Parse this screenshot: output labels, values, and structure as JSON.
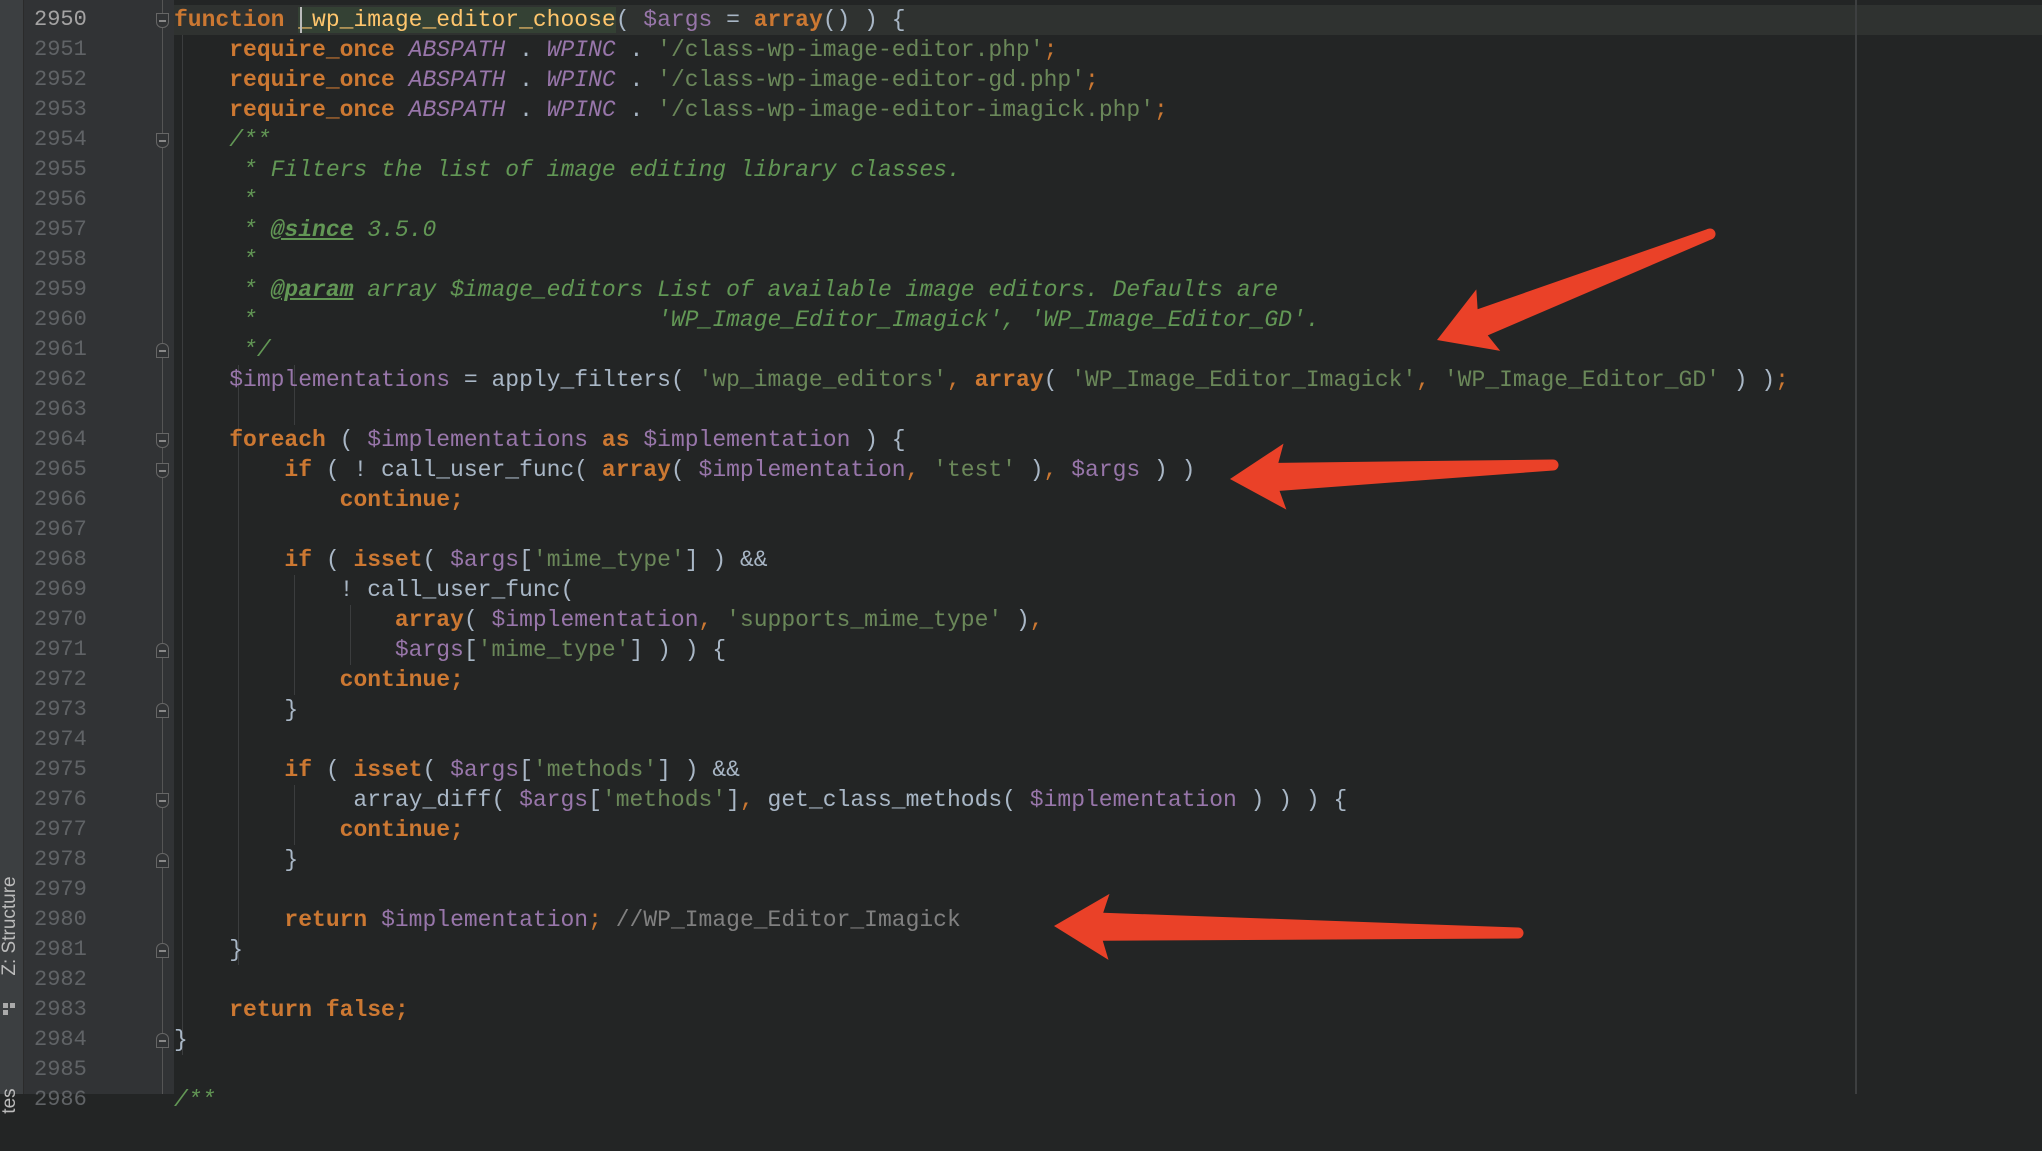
{
  "toolstrip": {
    "structure_label": "Z: Structure",
    "favorites_label": "tes"
  },
  "editor": {
    "first_line_number": 2950,
    "current_line": 2950,
    "annotation_color": "#ea4128",
    "fold_markers": {
      "2950": "top",
      "2954": "top",
      "2961": "bot",
      "2964": "top",
      "2965": "top",
      "2971": "bot",
      "2973": "bot",
      "2976": "top",
      "2978": "bot",
      "2981": "bot",
      "2984": "bot"
    },
    "lines": [
      [
        [
          "k",
          "function"
        ],
        [
          "p",
          " "
        ],
        [
          "f",
          "_wp_image_editor_choose"
        ],
        [
          "p",
          "( "
        ],
        [
          "v",
          "$args"
        ],
        [
          "p",
          " = "
        ],
        [
          "k",
          "array"
        ],
        [
          "p",
          "() ) {"
        ]
      ],
      [
        [
          "p",
          "    "
        ],
        [
          "k",
          "require_once"
        ],
        [
          "p",
          " "
        ],
        [
          "c",
          "ABSPATH"
        ],
        [
          "p",
          " . "
        ],
        [
          "c",
          "WPINC"
        ],
        [
          "p",
          " . "
        ],
        [
          "s",
          "'/class-wp-image-editor.php'"
        ],
        [
          "o",
          ";"
        ]
      ],
      [
        [
          "p",
          "    "
        ],
        [
          "k",
          "require_once"
        ],
        [
          "p",
          " "
        ],
        [
          "c",
          "ABSPATH"
        ],
        [
          "p",
          " . "
        ],
        [
          "c",
          "WPINC"
        ],
        [
          "p",
          " . "
        ],
        [
          "s",
          "'/class-wp-image-editor-gd.php'"
        ],
        [
          "o",
          ";"
        ]
      ],
      [
        [
          "p",
          "    "
        ],
        [
          "k",
          "require_once"
        ],
        [
          "p",
          " "
        ],
        [
          "c",
          "ABSPATH"
        ],
        [
          "p",
          " . "
        ],
        [
          "c",
          "WPINC"
        ],
        [
          "p",
          " . "
        ],
        [
          "s",
          "'/class-wp-image-editor-imagick.php'"
        ],
        [
          "o",
          ";"
        ]
      ],
      [
        [
          "p",
          "    "
        ],
        [
          "d",
          "/**"
        ]
      ],
      [
        [
          "p",
          "     "
        ],
        [
          "d",
          "* Filters the list of image editing library classes."
        ]
      ],
      [
        [
          "p",
          "     "
        ],
        [
          "d",
          "*"
        ]
      ],
      [
        [
          "p",
          "     "
        ],
        [
          "d",
          "* "
        ],
        [
          "t",
          "@since"
        ],
        [
          "d",
          " 3.5.0"
        ]
      ],
      [
        [
          "p",
          "     "
        ],
        [
          "d",
          "*"
        ]
      ],
      [
        [
          "p",
          "     "
        ],
        [
          "d",
          "* "
        ],
        [
          "t",
          "@param"
        ],
        [
          "d",
          " array $image_editors List of available image editors. Defaults are"
        ]
      ],
      [
        [
          "p",
          "     "
        ],
        [
          "d",
          "*                             'WP_Image_Editor_Imagick', 'WP_Image_Editor_GD'."
        ]
      ],
      [
        [
          "p",
          "     "
        ],
        [
          "d",
          "*/"
        ]
      ],
      [
        [
          "p",
          "    "
        ],
        [
          "v",
          "$implementations"
        ],
        [
          "p",
          " = apply_filters( "
        ],
        [
          "s",
          "'wp_image_editors'"
        ],
        [
          "o",
          ", "
        ],
        [
          "k",
          "array"
        ],
        [
          "p",
          "( "
        ],
        [
          "s",
          "'WP_Image_Editor_Imagick'"
        ],
        [
          "o",
          ", "
        ],
        [
          "s",
          "'WP_Image_Editor_GD'"
        ],
        [
          "p",
          " ) )"
        ],
        [
          "o",
          ";"
        ]
      ],
      [],
      [
        [
          "p",
          "    "
        ],
        [
          "k",
          "foreach"
        ],
        [
          "p",
          " ( "
        ],
        [
          "v",
          "$implementations"
        ],
        [
          "p",
          " "
        ],
        [
          "k",
          "as"
        ],
        [
          "p",
          " "
        ],
        [
          "v",
          "$implementation"
        ],
        [
          "p",
          " ) {"
        ]
      ],
      [
        [
          "p",
          "        "
        ],
        [
          "k",
          "if"
        ],
        [
          "p",
          " ( ! call_user_func( "
        ],
        [
          "k",
          "array"
        ],
        [
          "p",
          "( "
        ],
        [
          "v",
          "$implementation"
        ],
        [
          "o",
          ", "
        ],
        [
          "s",
          "'test'"
        ],
        [
          "p",
          " )"
        ],
        [
          "o",
          ", "
        ],
        [
          "v",
          "$args"
        ],
        [
          "p",
          " ) )"
        ]
      ],
      [
        [
          "p",
          "            "
        ],
        [
          "k",
          "continue;"
        ]
      ],
      [],
      [
        [
          "p",
          "        "
        ],
        [
          "k",
          "if"
        ],
        [
          "p",
          " ( "
        ],
        [
          "k",
          "isset"
        ],
        [
          "p",
          "( "
        ],
        [
          "v",
          "$args"
        ],
        [
          "p",
          "["
        ],
        [
          "s",
          "'mime_type'"
        ],
        [
          "p",
          "] ) &&"
        ]
      ],
      [
        [
          "p",
          "            ! call_user_func("
        ]
      ],
      [
        [
          "p",
          "                "
        ],
        [
          "k",
          "array"
        ],
        [
          "p",
          "( "
        ],
        [
          "v",
          "$implementation"
        ],
        [
          "o",
          ", "
        ],
        [
          "s",
          "'supports_mime_type'"
        ],
        [
          "p",
          " )"
        ],
        [
          "o",
          ","
        ]
      ],
      [
        [
          "p",
          "                "
        ],
        [
          "v",
          "$args"
        ],
        [
          "p",
          "["
        ],
        [
          "s",
          "'mime_type'"
        ],
        [
          "p",
          "] ) ) {"
        ]
      ],
      [
        [
          "p",
          "            "
        ],
        [
          "k",
          "continue;"
        ]
      ],
      [
        [
          "p",
          "        }"
        ]
      ],
      [],
      [
        [
          "p",
          "        "
        ],
        [
          "k",
          "if"
        ],
        [
          "p",
          " ( "
        ],
        [
          "k",
          "isset"
        ],
        [
          "p",
          "( "
        ],
        [
          "v",
          "$args"
        ],
        [
          "p",
          "["
        ],
        [
          "s",
          "'methods'"
        ],
        [
          "p",
          "] ) &&"
        ]
      ],
      [
        [
          "p",
          "             array_diff( "
        ],
        [
          "v",
          "$args"
        ],
        [
          "p",
          "["
        ],
        [
          "s",
          "'methods'"
        ],
        [
          "p",
          "]"
        ],
        [
          "o",
          ", "
        ],
        [
          "p",
          "get_class_methods( "
        ],
        [
          "v",
          "$implementation"
        ],
        [
          "p",
          " ) ) ) {"
        ]
      ],
      [
        [
          "p",
          "            "
        ],
        [
          "k",
          "continue;"
        ]
      ],
      [
        [
          "p",
          "        }"
        ]
      ],
      [],
      [
        [
          "p",
          "        "
        ],
        [
          "k",
          "return"
        ],
        [
          "p",
          " "
        ],
        [
          "v",
          "$implementation"
        ],
        [
          "o",
          ";"
        ],
        [
          "p",
          " "
        ],
        [
          "g",
          "//WP_Image_Editor_Imagick"
        ]
      ],
      [
        [
          "p",
          "    }"
        ]
      ],
      [],
      [
        [
          "p",
          "    "
        ],
        [
          "k",
          "return false;"
        ]
      ],
      [
        [
          "p",
          "}"
        ]
      ],
      [],
      [
        [
          "d",
          "/**"
        ]
      ]
    ]
  }
}
